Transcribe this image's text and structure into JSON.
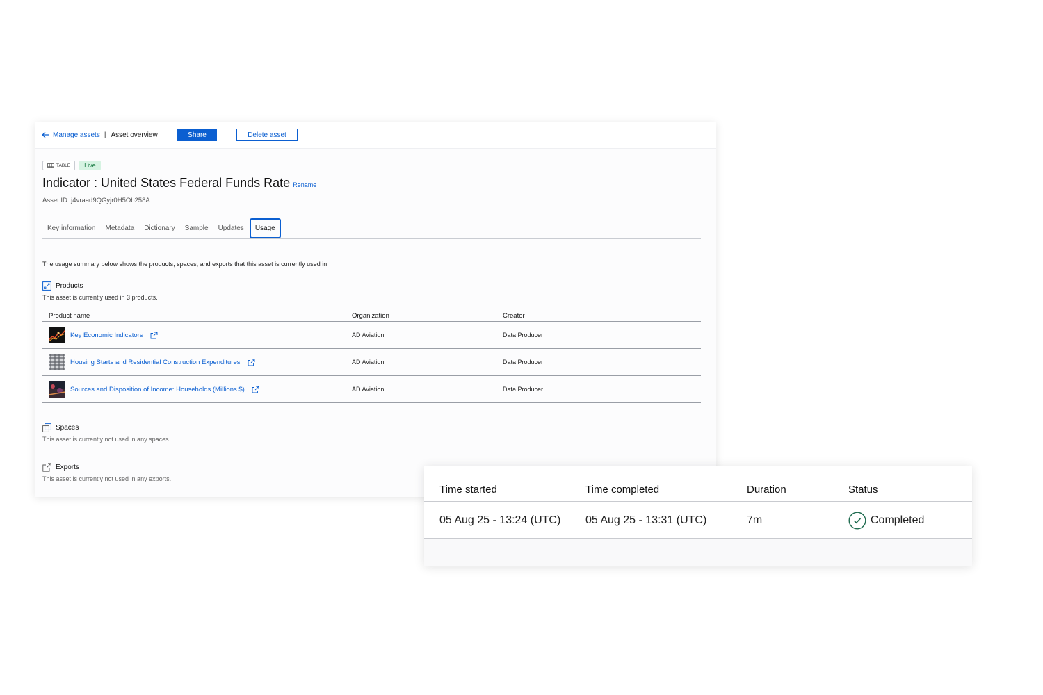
{
  "header": {
    "back_link": "Manage assets",
    "separator": "|",
    "current": "Asset overview",
    "share_label": "Share",
    "delete_label": "Delete asset"
  },
  "asset": {
    "type_badge": "TABLE",
    "status_badge": "Live",
    "title": "Indicator : United States Federal Funds Rate",
    "rename_label": "Rename",
    "asset_id": "Asset ID: j4vraad9QGyjr0H5Ob258A"
  },
  "tabs": [
    {
      "label": "Key information"
    },
    {
      "label": "Metadata"
    },
    {
      "label": "Dictionary"
    },
    {
      "label": "Sample"
    },
    {
      "label": "Updates"
    },
    {
      "label": "Usage",
      "active": true
    }
  ],
  "usage": {
    "summary": "The usage summary below shows the products, spaces, and exports that this asset is currently used in.",
    "products": {
      "heading": "Products",
      "description": "This asset is currently used in 3 products.",
      "columns": [
        "Product name",
        "Organization",
        "Creator"
      ],
      "rows": [
        {
          "name": "Key Economic Indicators",
          "organization": "AD Aviation",
          "creator": "Data Producer"
        },
        {
          "name": "Housing Starts and Residential Construction Expenditures",
          "organization": "AD Aviation",
          "creator": "Data Producer"
        },
        {
          "name": "Sources and Disposition of Income: Households (Millions $)",
          "organization": "AD Aviation",
          "creator": "Data Producer"
        }
      ]
    },
    "spaces": {
      "heading": "Spaces",
      "description": "This asset is currently not used in any spaces."
    },
    "exports": {
      "heading": "Exports",
      "description": "This asset is currently not used in any exports."
    }
  },
  "job_table": {
    "columns": [
      "Time started",
      "Time completed",
      "Duration",
      "Status"
    ],
    "rows": [
      {
        "started": "05 Aug 25 - 13:24 (UTC)",
        "completed": "05 Aug 25 - 13:31 (UTC)",
        "duration": "7m",
        "status": "Completed"
      }
    ]
  },
  "colors": {
    "accent": "#0b5fd1",
    "live_bg": "#d6f3e2",
    "live_text": "#197a43",
    "success": "#1e6b4f"
  }
}
